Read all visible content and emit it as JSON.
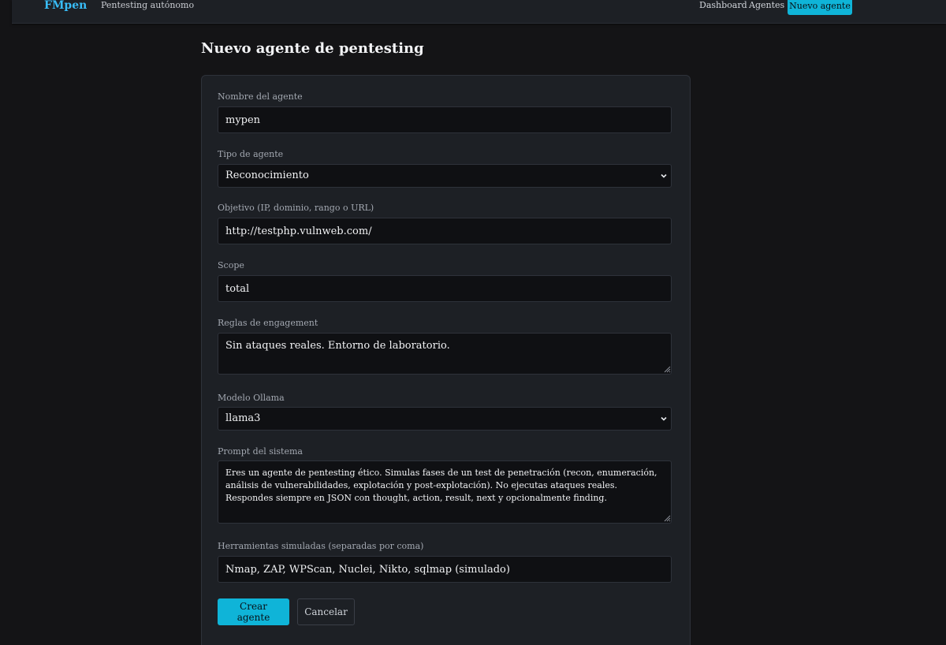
{
  "nav": {
    "brand": "FMpen",
    "tagline": "Pentesting autónomo",
    "links": [
      "Dashboard",
      "Agentes"
    ],
    "new_agent": "Nuevo agente"
  },
  "page": {
    "title": "Nuevo agente de pentesting"
  },
  "form": {
    "name": {
      "label": "Nombre del agente",
      "value": "mypen"
    },
    "type": {
      "label": "Tipo de agente",
      "value": "Reconocimiento"
    },
    "target": {
      "label": "Objetivo (IP, dominio, rango o URL)",
      "value": "http://testphp.vulnweb.com/"
    },
    "scope": {
      "label": "Scope",
      "value": "total"
    },
    "rules": {
      "label": "Reglas de engagement",
      "value": "Sin ataques reales. Entorno de laboratorio."
    },
    "model": {
      "label": "Modelo Ollama",
      "value": "llama3"
    },
    "prompt": {
      "label": "Prompt del sistema",
      "value": "Eres un agente de pentesting ético. Simulas fases de un test de penetración (recon, enumeración, análisis de vulnerabilidades, explotación y post-explotación). No ejecutas ataques reales. Respondes siempre en JSON con thought, action, result, next y opcionalmente finding."
    },
    "tools": {
      "label": "Herramientas simuladas (separadas por coma)",
      "value": "Nmap, ZAP, WPScan, Nuclei, Nikto, sqlmap (simulado)"
    },
    "submit": "Crear agente",
    "cancel": "Cancelar"
  },
  "colors": {
    "accent": "#0fb4d8",
    "brand": "#38bdf8",
    "background": "#141416",
    "card": "#1d2025",
    "input": "#0f1013"
  }
}
